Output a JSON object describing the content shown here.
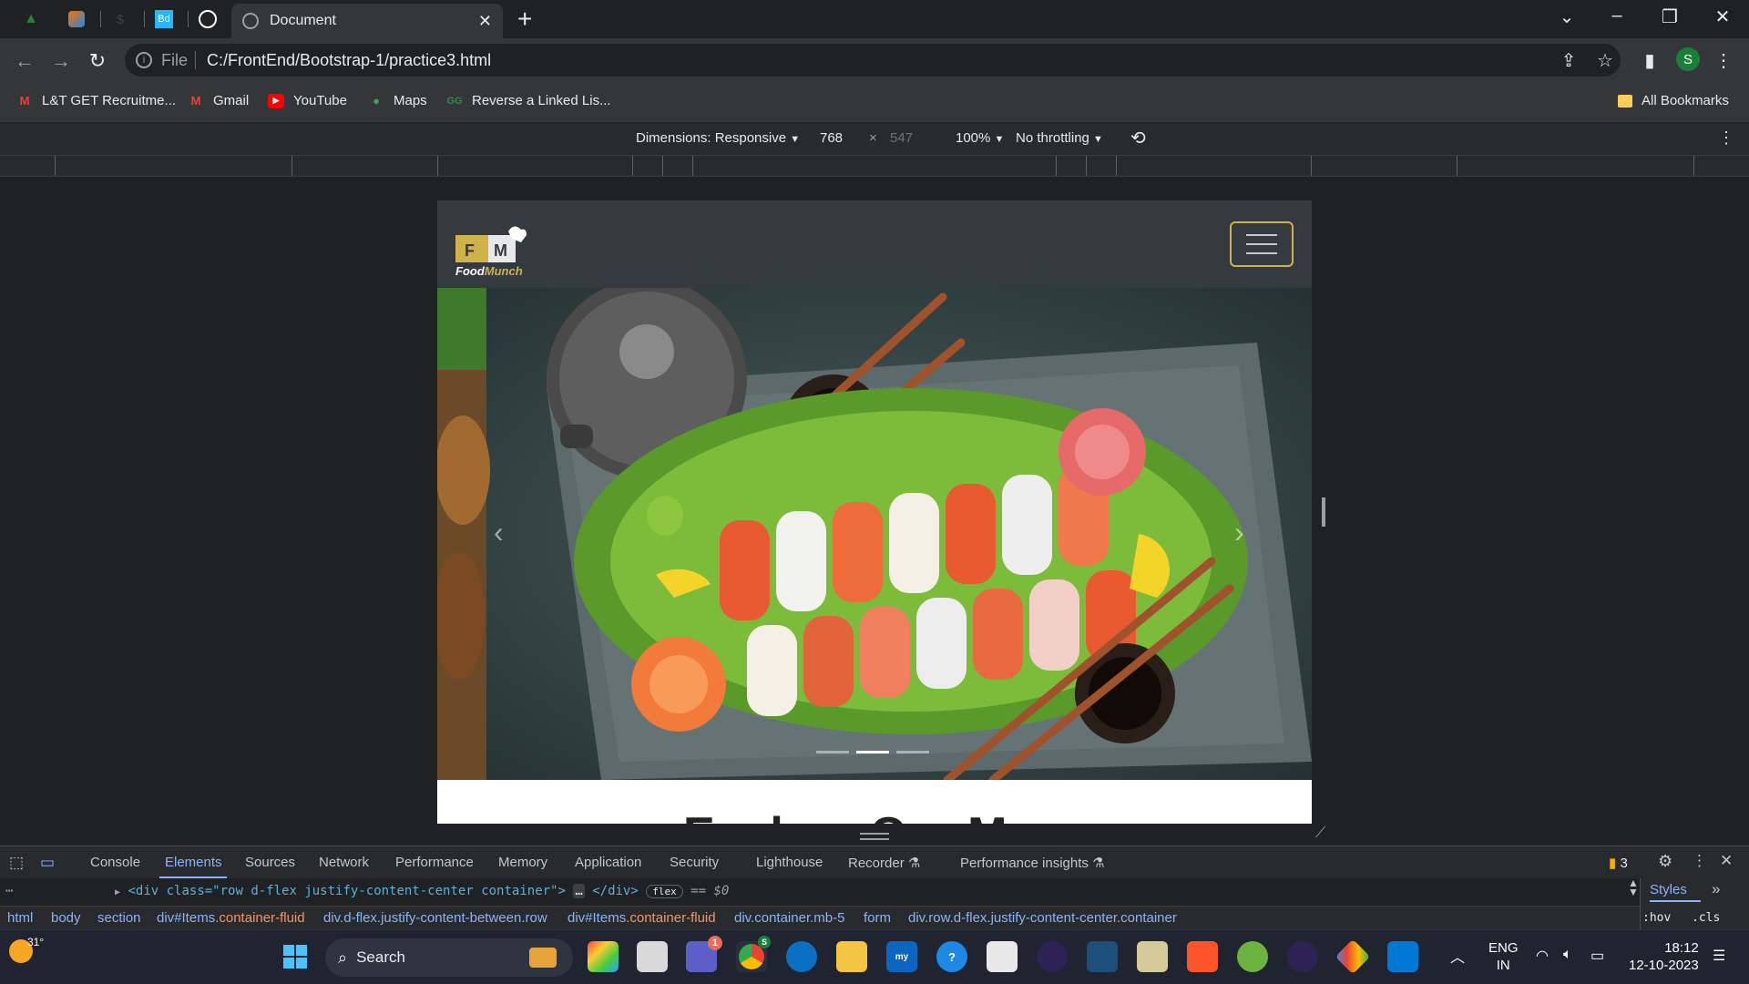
{
  "browser": {
    "active_tab_title": "Document",
    "pinned_tabs": [
      "coin-icon",
      "pen-icon",
      "dollar-icon",
      "bd-icon",
      "openai-icon"
    ],
    "url_scheme_label": "File",
    "url": "C:/FrontEnd/Bootstrap-1/practice3.html",
    "profile_initial": "S"
  },
  "bookmarks": {
    "items": [
      {
        "label": "L&T GET Recruitme...",
        "icon": "gmail-icon"
      },
      {
        "label": "Gmail",
        "icon": "gmail-icon"
      },
      {
        "label": "YouTube",
        "icon": "youtube-icon"
      },
      {
        "label": "Maps",
        "icon": "maps-icon"
      },
      {
        "label": "Reverse a Linked Lis...",
        "icon": "gfg-icon"
      }
    ],
    "all_bookmarks": "All Bookmarks"
  },
  "device_toolbar": {
    "dimensions_label": "Dimensions: Responsive",
    "width": "768",
    "times": "×",
    "height": "547",
    "zoom": "100%",
    "throttling": "No throttling"
  },
  "page": {
    "brand_primary": "Food",
    "brand_secondary": "Munch",
    "logo_letters": [
      "F",
      "M"
    ],
    "heading_peek": "Explore Our Menu",
    "colors": {
      "navbar": "#343a40",
      "logo_yellow": "#d0b24a",
      "toggler_border": "#d0b24a"
    }
  },
  "devtools": {
    "tabs": [
      "Console",
      "Elements",
      "Sources",
      "Network",
      "Performance",
      "Memory",
      "Application",
      "Security",
      "Lighthouse",
      "Recorder",
      "Performance insights"
    ],
    "active_tab": "Elements",
    "issues_count": "3",
    "element_line": {
      "open": "<div class=\"row d-flex justify-content-center container\">",
      "ellipsis": "…",
      "close": "</div>",
      "badge": "flex",
      "equals": "== $0"
    },
    "breadcrumbs": [
      {
        "base": "html",
        "hl": ""
      },
      {
        "base": "body",
        "hl": ""
      },
      {
        "base": "section",
        "hl": ""
      },
      {
        "base": "div#Items",
        "hl": ".container-fluid"
      },
      {
        "base": "div.d-flex.justify-content-between.row",
        "hl": ""
      },
      {
        "base": "div#Items",
        "hl": ".container-fluid"
      },
      {
        "base": "div.container.mb-5",
        "hl": ""
      },
      {
        "base": "form",
        "hl": ""
      },
      {
        "base": "div.row.d-flex.justify-content-center.container",
        "hl": ""
      }
    ],
    "styles_label": "Styles",
    "hov_label": ":hov",
    "cls_label": ".cls"
  },
  "taskbar": {
    "weather_temp": "31°",
    "search_placeholder": "Search",
    "lang_line1": "ENG",
    "lang_line2": "IN",
    "time": "18:12",
    "date": "12-10-2023",
    "chrome_badge": "S",
    "teams_badge": "1"
  }
}
